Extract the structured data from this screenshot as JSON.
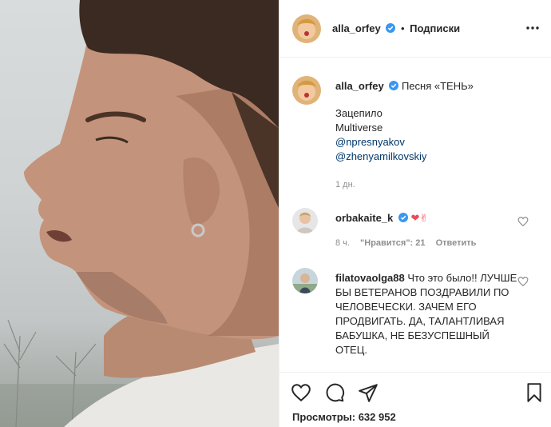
{
  "post": {
    "author": "alla_orfey",
    "follow_label": "Подписки",
    "separator": "•",
    "caption_title": "Песня «ТЕНЬ»",
    "caption_lines": [
      "Зацепило",
      "Multiverse",
      "@npresnyakov",
      "@zhenyamilkovskiy"
    ],
    "time": "1 дн.",
    "views_label": "Просмотры: 632 952"
  },
  "comments": [
    {
      "user": "orbakaite_k",
      "text": "",
      "emoji": "❤✌",
      "time": "8 ч.",
      "likes": "\"Нравится\": 21",
      "reply": "Ответить"
    },
    {
      "user": "filatovaolga88",
      "text": "Что это было!! ЛУЧШЕ БЫ ВЕТЕРАНОВ ПОЗДРАВИЛИ ПО ЧЕЛОВЕЧЕСКИ. ЗАЧЕМ ЕГО ПРОДВИГАТЬ. ДА, ТАЛАНТЛИВАЯ БАБУШКА, НЕ БЕЗУСПЕШНЫЙ ОТЕЦ."
    }
  ],
  "icons": {
    "verified": "verified-badge-icon",
    "more": "more-options-icon",
    "like": "heart-icon",
    "comment": "comment-icon",
    "share": "share-icon",
    "save": "bookmark-icon"
  },
  "colors": {
    "verified": "#3897f0",
    "link": "#00376b",
    "muted": "#8e8e8e",
    "heart_emoji": "#ed4956"
  }
}
